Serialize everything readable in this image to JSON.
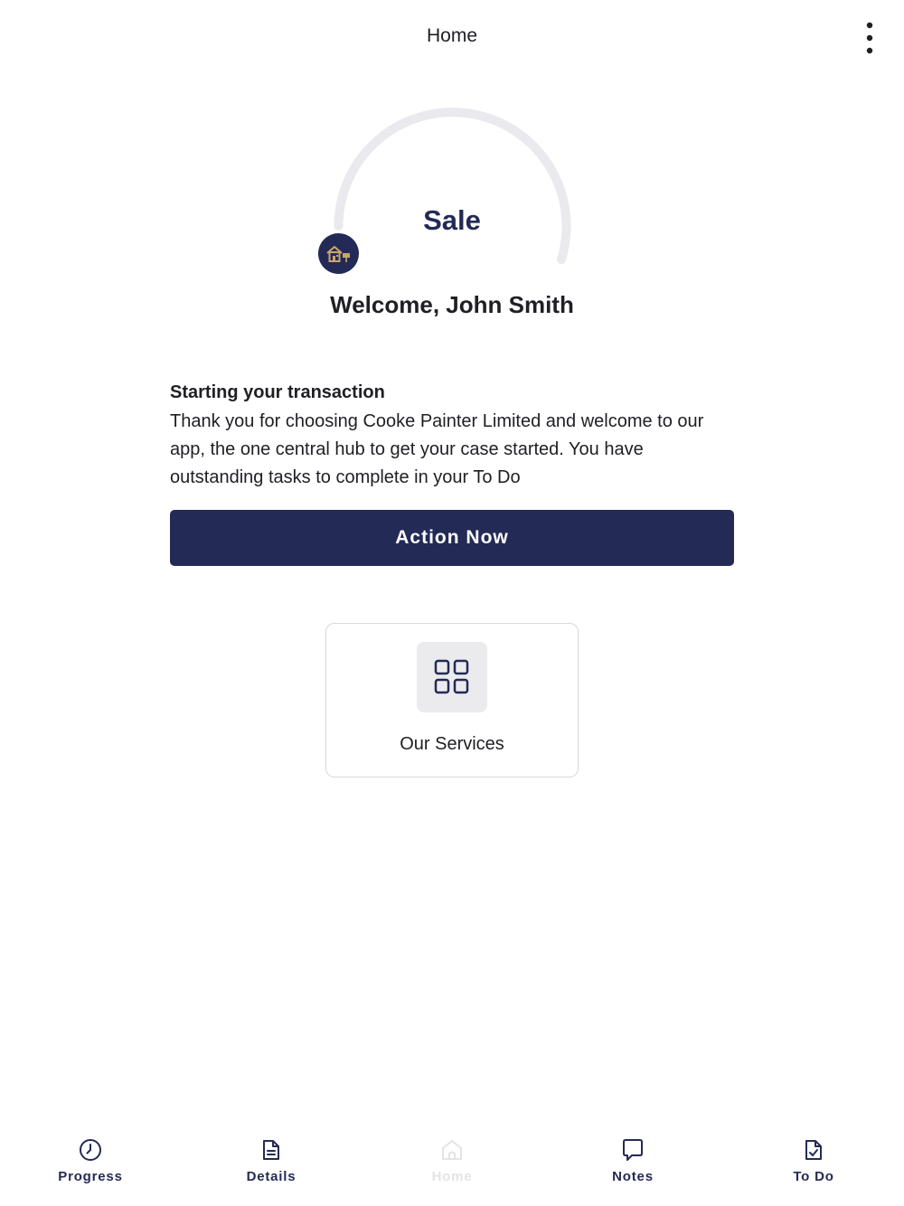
{
  "header": {
    "title": "Home"
  },
  "stage": {
    "label": "Sale",
    "progress_percent": 5
  },
  "welcome": {
    "text": "Welcome, John Smith"
  },
  "intro": {
    "heading": "Starting your transaction",
    "body": "Thank you for choosing Cooke Painter Limited and welcome to our app, the one central hub to get your case started. You have outstanding tasks to complete in your To Do"
  },
  "action_button": {
    "label": "Action Now"
  },
  "services_card": {
    "label": "Our Services",
    "icon": "grid-icon"
  },
  "bottom_nav": {
    "items": [
      {
        "label": "Progress",
        "icon": "clock-icon",
        "active": true
      },
      {
        "label": "Details",
        "icon": "document-icon",
        "active": true
      },
      {
        "label": "Home",
        "icon": "home-icon",
        "active": false
      },
      {
        "label": "Notes",
        "icon": "speech-bubble-icon",
        "active": true
      },
      {
        "label": "To Do",
        "icon": "checked-document-icon",
        "active": true
      }
    ]
  },
  "colors": {
    "primary": "#242a56",
    "ring_track": "#e9e9ee",
    "disabled": "#e3e3e8",
    "marker_icon": "#c9a66b"
  }
}
